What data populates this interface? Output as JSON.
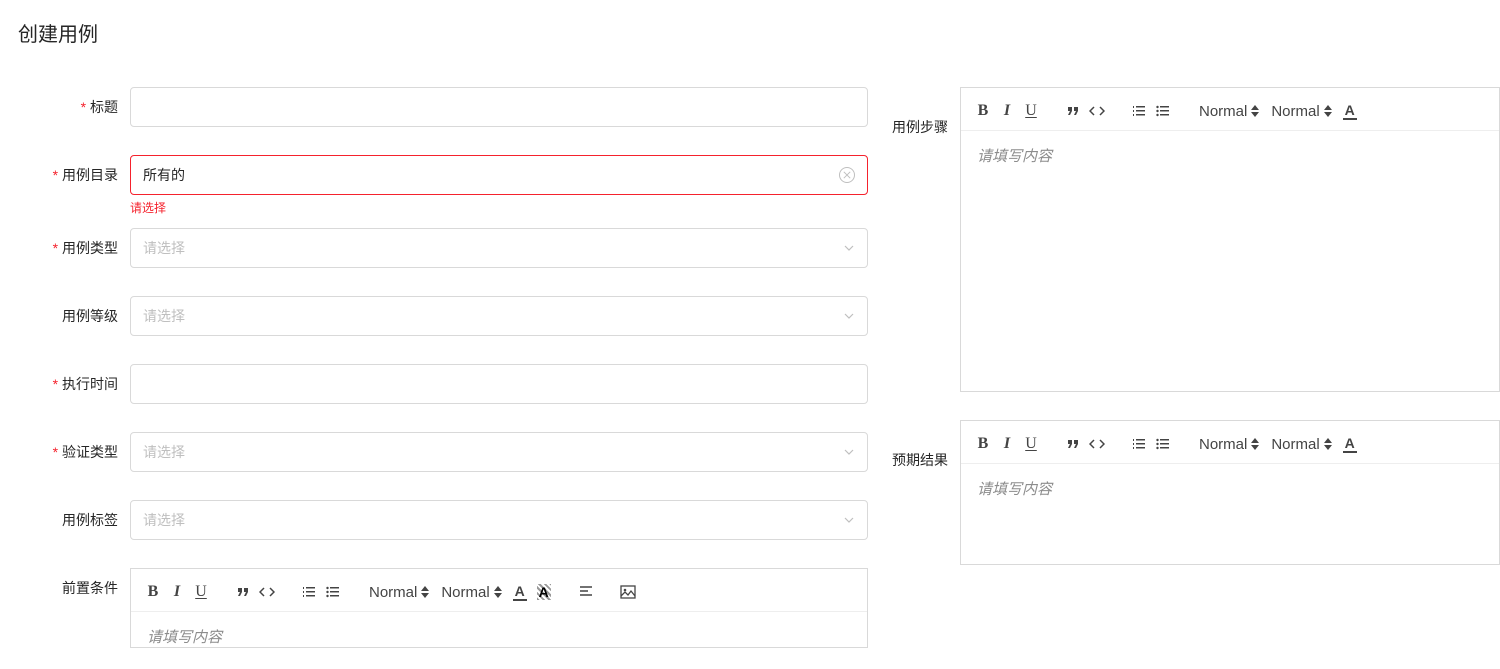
{
  "title": "创建用例",
  "form": {
    "title_label": "标题",
    "title_value": "",
    "dir_label": "用例目录",
    "dir_value": "所有的",
    "dir_error": "请选择",
    "type_label": "用例类型",
    "type_placeholder": "请选择",
    "level_label": "用例等级",
    "level_placeholder": "请选择",
    "exec_label": "执行时间",
    "exec_value": "",
    "verify_label": "验证类型",
    "verify_placeholder": "请选择",
    "tag_label": "用例标签",
    "tag_placeholder": "请选择",
    "precond_label": "前置条件",
    "precond_placeholder": "请填写内容"
  },
  "right": {
    "steps_label": "用例步骤",
    "steps_placeholder": "请填写内容",
    "result_label": "预期结果",
    "result_placeholder": "请填写内容"
  },
  "toolbar": {
    "normal1": "Normal",
    "normal2": "Normal"
  }
}
